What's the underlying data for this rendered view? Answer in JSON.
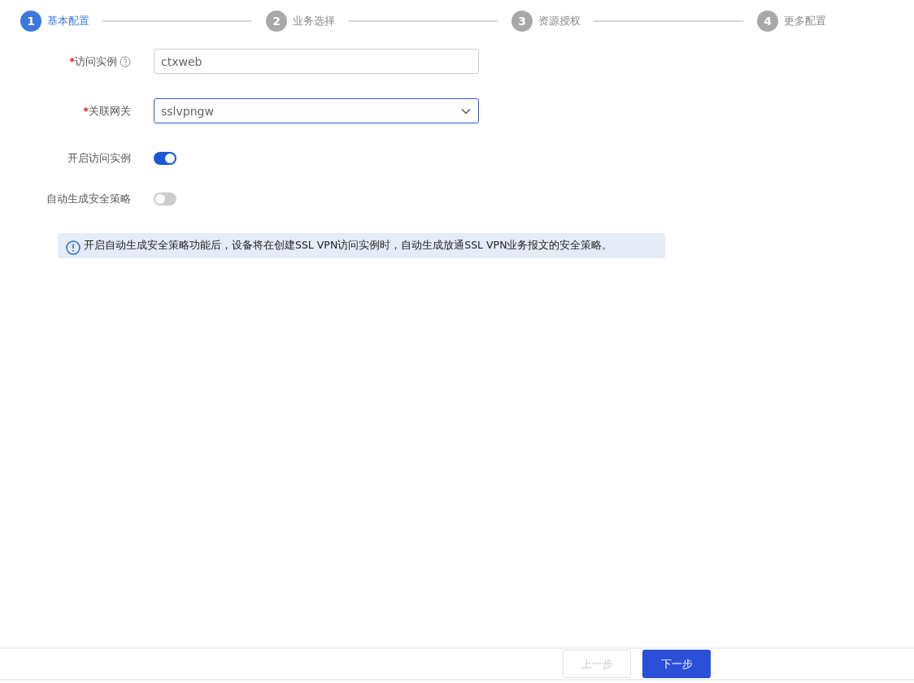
{
  "steps": [
    {
      "number": "1",
      "label": "基本配置",
      "selected": true
    },
    {
      "number": "2",
      "label": "业务选择",
      "selected": false
    },
    {
      "number": "3",
      "label": "资源授权",
      "selected": false
    },
    {
      "number": "4",
      "label": "更多配置",
      "selected": false
    }
  ],
  "form": [
    {
      "kind": "input",
      "label": "访问实例",
      "required_mark": "*",
      "help": true,
      "value": "ctxweb"
    },
    {
      "kind": "select",
      "label": "关联网关",
      "required_mark": "*",
      "help": false,
      "value": "sslvpngw"
    },
    {
      "kind": "toggle",
      "label": "开启访问实例",
      "help": false,
      "on": true
    },
    {
      "kind": "toggle",
      "label": "自动生成安全策略",
      "help": false,
      "on": false
    }
  ],
  "notice": "开启自动生成安全策略功能后，设备将在创建SSL VPN访问实例时，自动生成放通SSL VPN业务报文的安全策略。",
  "buttons": [
    {
      "label": "上一步",
      "kind": "secondary",
      "disabled": true
    },
    {
      "label": "下一步",
      "kind": "primary",
      "disabled": false
    }
  ]
}
